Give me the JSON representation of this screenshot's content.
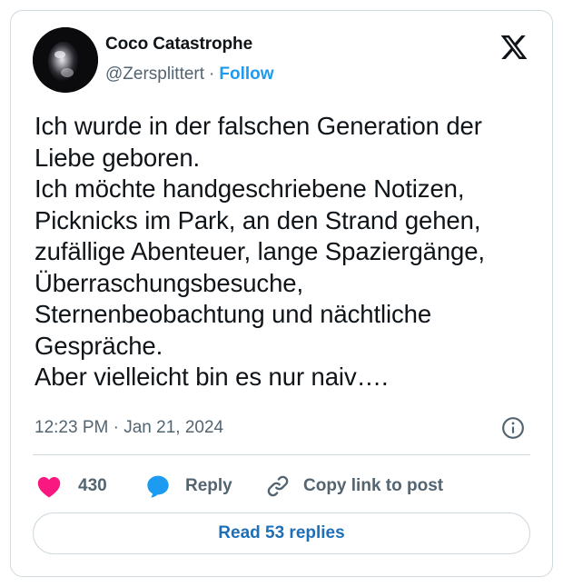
{
  "author": {
    "display_name": "Coco Catastrophe",
    "handle": "@Zersplittert",
    "separator": "·",
    "follow_label": "Follow"
  },
  "tweet": {
    "text": "Ich wurde in der falschen Generation der\nLiebe geboren.\nIch möchte handgeschriebene Notizen,\nPicknicks im Park, an den Strand gehen,\nzufällige Abenteuer, lange Spaziergänge,\nÜberraschungsbesuche,\nSternenbeobachtung und nächtliche\nGespräche.\nAber vielleicht bin es nur naiv….",
    "timestamp": "12:23 PM · Jan 21, 2024"
  },
  "actions": {
    "like_count": "430",
    "reply_label": "Reply",
    "copy_link_label": "Copy link to post"
  },
  "footer": {
    "read_replies_label": "Read 53 replies"
  },
  "icons": {
    "brand": "x-logo-icon",
    "info": "info-icon",
    "like": "heart-icon",
    "reply": "speech-bubble-icon",
    "copy": "link-icon"
  },
  "colors": {
    "accent": "#1d9bf0",
    "like": "#f91880",
    "muted": "#536471",
    "text": "#0f1419",
    "border": "#cfd9de"
  }
}
